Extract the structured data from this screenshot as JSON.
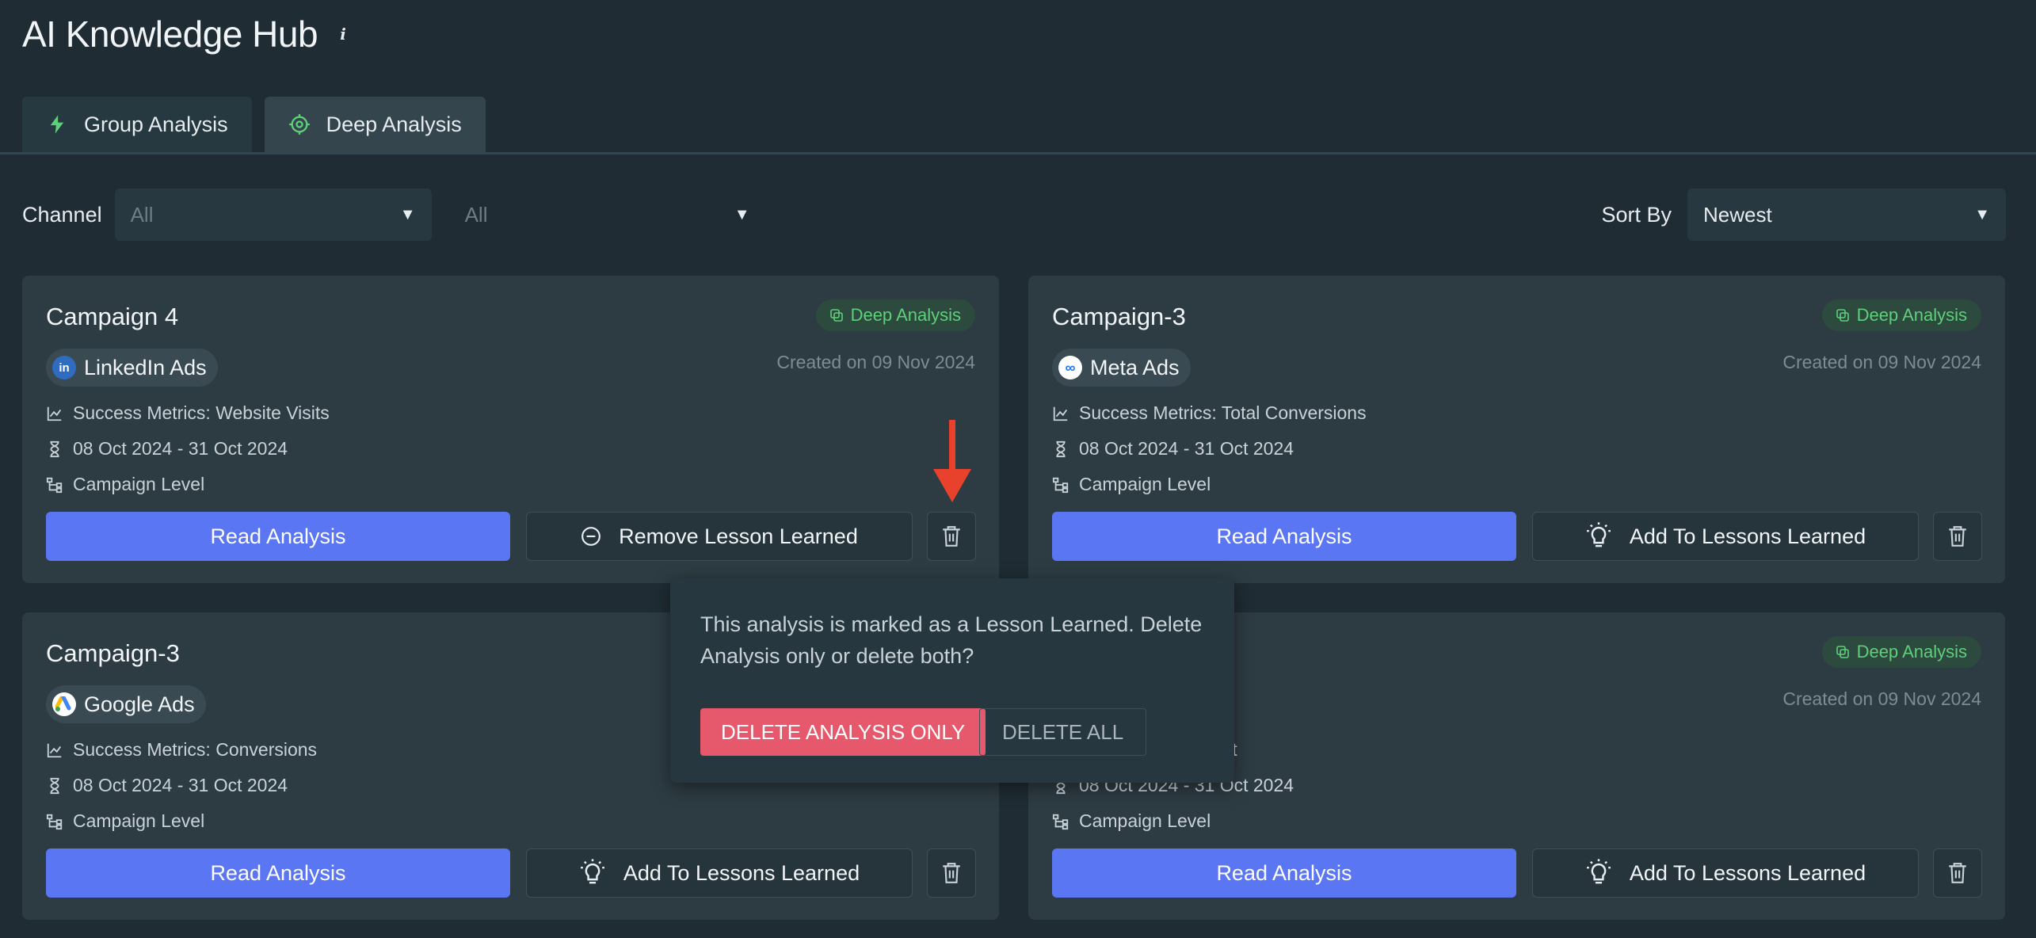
{
  "header": {
    "title": "AI Knowledge Hub"
  },
  "tabs": [
    {
      "label": "Group Analysis",
      "icon": "bolt-icon"
    },
    {
      "label": "Deep Analysis",
      "icon": "target-icon"
    }
  ],
  "filters": {
    "channel_label": "Channel",
    "channel_value": "All",
    "second_value": "All",
    "sort_label": "Sort By",
    "sort_value": "Newest"
  },
  "cards": [
    {
      "title": "Campaign 4",
      "badge": "Deep Analysis",
      "channel": "LinkedIn Ads",
      "created": "Created on 09 Nov 2024",
      "metric": "Success Metrics: Website Visits",
      "dates": "08 Oct 2024 - 31 Oct 2024",
      "level": "Campaign Level",
      "read_label": "Read Analysis",
      "lesson_label": "Remove Lesson Learned"
    },
    {
      "title": "Campaign-3",
      "badge": "Deep Analysis",
      "channel": "Meta Ads",
      "created": "Created on 09 Nov 2024",
      "metric": "Success Metrics: Total Conversions",
      "dates": "08 Oct 2024 - 31 Oct 2024",
      "level": "Campaign Level",
      "read_label": "Read Analysis",
      "lesson_label": "Add To Lessons Learned"
    },
    {
      "title": "Campaign-3",
      "channel": "Google Ads",
      "metric": "Success Metrics: Conversions",
      "dates": "08 Oct 2024 - 31 Oct 2024",
      "level": "Campaign Level",
      "read_label": "Read Analysis",
      "lesson_label": "Add To Lessons Learned"
    },
    {
      "badge": "Deep Analysis",
      "created": "Created on 09 Nov 2024",
      "metric_partial": "esult",
      "dates": "08 Oct 2024 - 31 Oct 2024",
      "level": "Campaign Level",
      "read_label": "Read Analysis",
      "lesson_label": "Add To Lessons Learned"
    }
  ],
  "popover": {
    "message": "This analysis is marked as a Lesson Learned. Delete Analysis only or delete both?",
    "delete_only_label": "DELETE ANALYSIS ONLY",
    "delete_all_label": "DELETE ALL"
  },
  "colors": {
    "background": "#1f2c33",
    "card": "#2d3c43",
    "primary": "#5b76f2",
    "badge_green": "#5ed07a",
    "danger": "#e6586b",
    "annotation_arrow": "#e8422c"
  }
}
